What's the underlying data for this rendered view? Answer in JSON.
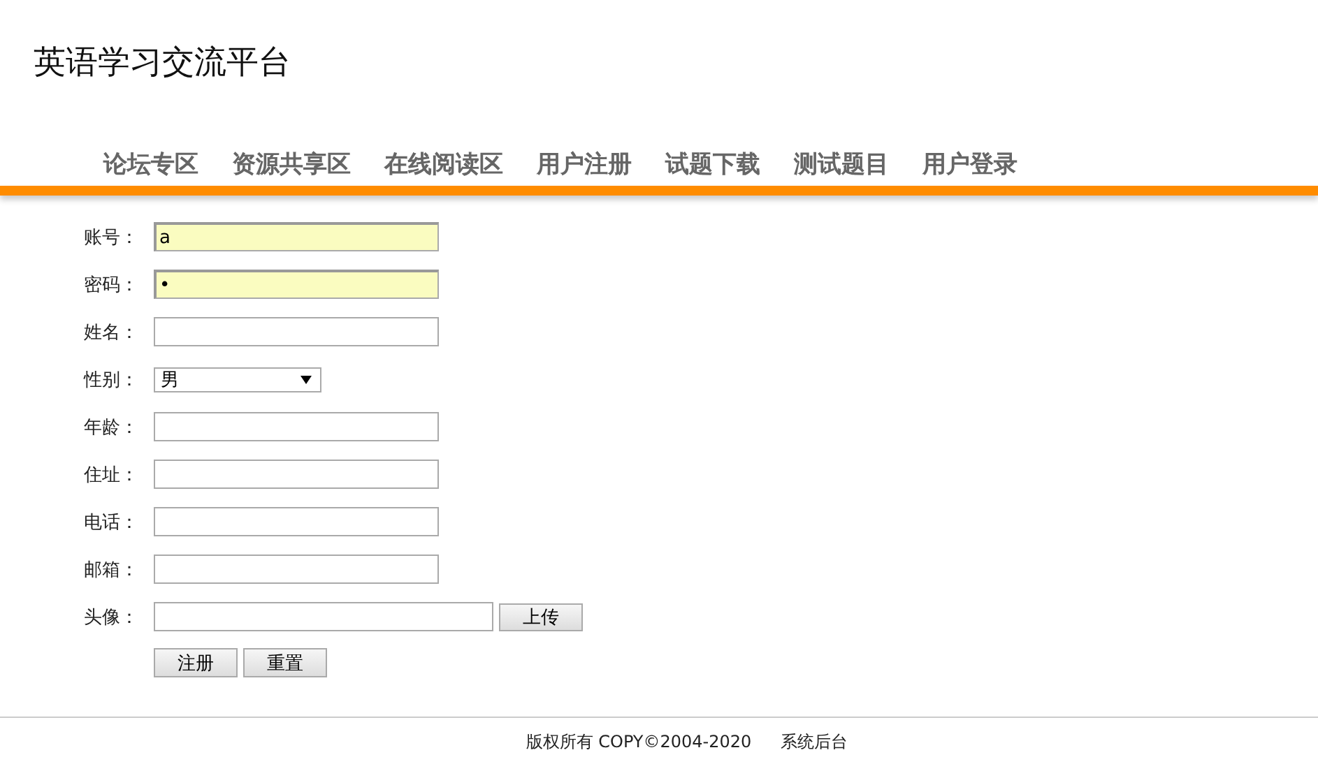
{
  "site_title": "英语学习交流平台",
  "nav": [
    {
      "label": "论坛专区"
    },
    {
      "label": "资源共享区"
    },
    {
      "label": "在线阅读区"
    },
    {
      "label": "用户注册"
    },
    {
      "label": "试题下载"
    },
    {
      "label": "测试题目"
    },
    {
      "label": "用户登录"
    }
  ],
  "form": {
    "fields": [
      {
        "label": "账号：",
        "kind": "text",
        "value": "a",
        "autofilled": true
      },
      {
        "label": "密码：",
        "kind": "text",
        "value": "•",
        "autofilled": true
      },
      {
        "label": "姓名：",
        "kind": "text",
        "autofilled": false
      },
      {
        "label": "性别：",
        "kind": "select",
        "value": "男"
      },
      {
        "label": "年龄：",
        "kind": "text",
        "autofilled": false
      },
      {
        "label": "住址：",
        "kind": "text",
        "autofilled": false
      },
      {
        "label": "电话：",
        "kind": "text",
        "autofilled": false
      },
      {
        "label": "邮箱：",
        "kind": "text",
        "autofilled": false
      },
      {
        "label": "头像：",
        "kind": "file",
        "button": "上传"
      }
    ],
    "buttons": [
      "注册",
      "重置"
    ]
  },
  "footer": {
    "copyright": "版权所有 COPY©2004-2020",
    "admin_link": "系统后台"
  }
}
